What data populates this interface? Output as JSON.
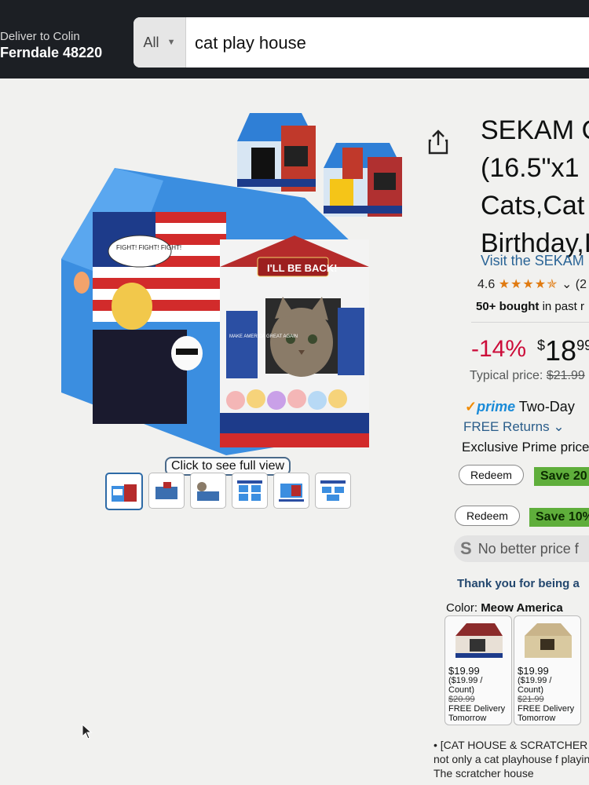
{
  "header": {
    "deliver_line1": "Deliver to Colin",
    "deliver_line2": "Ferndale 48220",
    "search_category": "All",
    "search_query": "cat play house"
  },
  "gallery": {
    "full_view_label": "Click to see full view",
    "hero_banner": "I'LL BE BACK!",
    "sign_text": "MAKE AMERICA GREAT AGAIN",
    "speech_text": "FIGHT! FIGHT! FIGHT!",
    "thumbnail_count": 6
  },
  "product": {
    "title_lines": [
      "SEKAM C",
      "(16.5\"x1",
      "Cats,Cat I",
      "Birthday,I"
    ],
    "visit_store": "Visit the SEKAM",
    "rating_value": "4.6",
    "rating_stars": "★★★★✯",
    "rating_suffix": "(2",
    "bought_bold": "50+ bought",
    "bought_rest": " in past r",
    "discount": "-14%",
    "price_currency": "$",
    "price_whole": "18",
    "price_fraction": "99",
    "typical_label": "Typical price: ",
    "typical_price": "$21.99",
    "prime_check": "✓",
    "prime_word": "prime",
    "prime_delivery": " Two-Day",
    "free_returns": "FREE Returns",
    "exclusive": "Exclusive Prime price"
  },
  "coupons": [
    {
      "redeem": "Redeem",
      "save": "Save 20"
    },
    {
      "redeem": "Redeem",
      "save": "Save 10%"
    }
  ],
  "price_tracker": {
    "letter": "S",
    "text": "No better price f"
  },
  "thank_you": "Thank you for being a",
  "color": {
    "label": "Color: ",
    "value": "Meow America"
  },
  "swatches": [
    {
      "price": "$19.99",
      "unit": "($19.99 /",
      "count": "Count)",
      "list": "$20.99",
      "delivery": "FREE Delivery",
      "when": "Tomorrow"
    },
    {
      "price": "$19.99",
      "unit": "($19.99 /",
      "count": "Count)",
      "list": "$21.99",
      "delivery": "FREE Delivery",
      "when": "Tomorrow"
    }
  ],
  "bullet": "[CAT HOUSE & SCRATCHER is not only a cat playhouse f playing. The scratcher house",
  "colors": {
    "header_bg": "#1c1f24",
    "deal_red": "#cc0c39",
    "save_green": "#5fae3b",
    "link_blue": "#2a6496"
  }
}
